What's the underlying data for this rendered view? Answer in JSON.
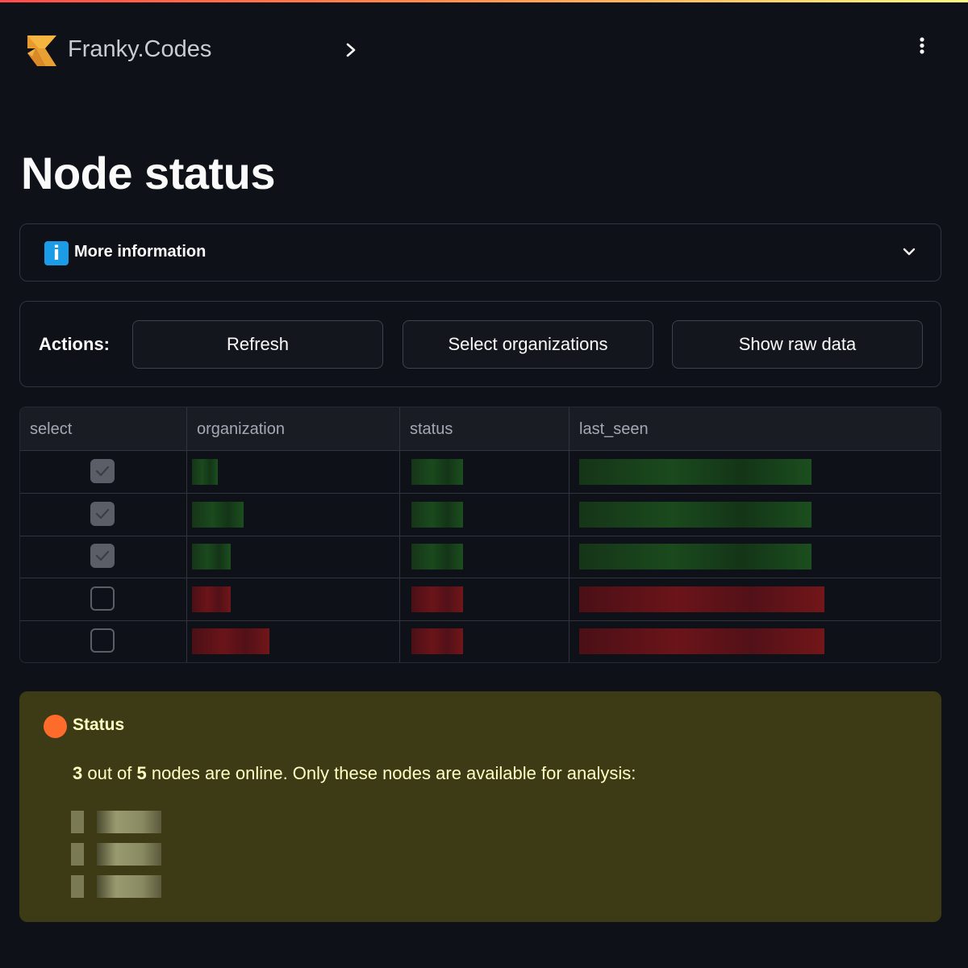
{
  "header": {
    "brand": "Franky.Codes",
    "logo_icon": "franky-codes-logo",
    "sidebar_toggle_icon": "chevron-right-icon",
    "menu_icon": "kebab-menu-icon"
  },
  "page": {
    "title": "Node status"
  },
  "expander": {
    "icon": "info-icon",
    "icon_glyph": "i",
    "label": "More information",
    "chevron_icon": "chevron-down-icon",
    "expanded": false
  },
  "actions": {
    "label": "Actions:",
    "buttons": [
      {
        "label": "Refresh"
      },
      {
        "label": "Select organizations"
      },
      {
        "label": "Show raw data"
      }
    ]
  },
  "table": {
    "columns": [
      "select",
      "organization",
      "status",
      "last_seen"
    ],
    "rows": [
      {
        "select": true,
        "organization": "[redacted]",
        "status": "[redacted]",
        "last_seen": "[redacted]",
        "tone": "online"
      },
      {
        "select": true,
        "organization": "[redacted]",
        "status": "[redacted]",
        "last_seen": "[redacted]",
        "tone": "online"
      },
      {
        "select": true,
        "organization": "[redacted]",
        "status": "[redacted]",
        "last_seen": "[redacted]",
        "tone": "online"
      },
      {
        "select": false,
        "organization": "[redacted]",
        "status": "[redacted]",
        "last_seen": "[redacted]",
        "tone": "offline"
      },
      {
        "select": false,
        "organization": "[redacted]",
        "status": "[redacted]",
        "last_seen": "[redacted]",
        "tone": "offline"
      }
    ]
  },
  "status_callout": {
    "icon": "orange-circle-icon",
    "title": "Status",
    "online_count": "3",
    "text_mid": " out of ",
    "total_count": "5",
    "text_end": " nodes are online. Only these nodes are available for analysis:",
    "nodes": [
      "[redacted]",
      "[redacted]",
      "[redacted]"
    ]
  },
  "colors": {
    "background": "#0e1117",
    "accent_online": "#1b4e1e",
    "accent_offline": "#721619",
    "warning_bg": "#3d3b16",
    "warning_text": "#ffffc2",
    "info_blue": "#1c9be6",
    "status_dot": "#ff6b2b"
  }
}
